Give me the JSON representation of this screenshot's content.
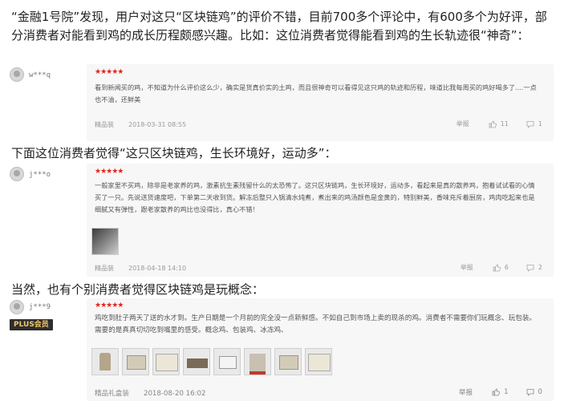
{
  "intro_paragraph": "“金融1号院”发现，用户对这只“区块链鸡”的评价不错，目前700多个评论中，有600多个为好评，部分消费者对能看到鸡的成长历程颇感兴趣。比如：这位消费者觉得能看到鸡的生长轨迹很“神奇”：",
  "middle_paragraph": "下面这位消费者觉得“这只区块链鸡，生长环境好，运动多”：",
  "end_paragraph": "当然，也有个别消费者觉得区块链鸡是玩概念：",
  "colors": {
    "star": "#e1251b",
    "card_bg": "#f7f7f7",
    "plus_badge_bg": "#2e2e2e",
    "plus_badge_text": "#f3c869"
  },
  "stars": "★★★★★",
  "reviews": [
    {
      "username": "w***q",
      "text": "看到新闻买的鸡，不知道为什么评价这么少，确实是货真价实的土鸡，而且很神奇可以看得见这只鸡的轨迹和历程，味道比我每周买的鸡好喝多了....一点也不油，还鲜美",
      "product": "精品装",
      "date": "2018-03-31 08:55",
      "report_label": "举报",
      "likes": "11",
      "replies": "1"
    },
    {
      "username": "j***o",
      "text": "一般家里不买鸡，除非是老家养的鸡，激素抗生素残留什么的太恐怖了。这只区块链鸡，生长环境好，运动多，看起来是真的散养鸡，抱着试试看的心情买了一只。先说送货速度吧，下单第二天收到货。解冻后整只入锅清水炖煮，煮出来的鸡汤颜色是金黄的，特别鲜美，香味充斥着厨房，鸡肉吃起来也是细腻又有弹性，跟老家散养的鸡比也没得比，真心不错！",
      "product": "精品装",
      "date": "2018-04-18 14:10",
      "report_label": "举报",
      "likes": "6",
      "replies": "2",
      "images": [
        "photo-thumbnail"
      ]
    },
    {
      "username": "j***9",
      "badge": "PLUS会员",
      "text": "鸡吃到肚子两天了送的水才到。生产日期是一个月前的完全没一点新鲜感。不如自己到市场上卖的现杀的鸡。消费者不需要你们玩概念、玩包装。需要的是真真切切吃到嘴里的感受。概念鸡、包装鸡、冰冻鸡、",
      "product": "精品礼盒装",
      "date": "2018-08-20 16:02",
      "report_label": "举报",
      "likes": "1",
      "replies": "0",
      "images": [
        "photo-thumbnail",
        "photo-thumbnail",
        "photo-thumbnail",
        "photo-thumbnail",
        "photo-thumbnail",
        "photo-thumbnail",
        "photo-thumbnail",
        "photo-thumbnail"
      ]
    }
  ]
}
